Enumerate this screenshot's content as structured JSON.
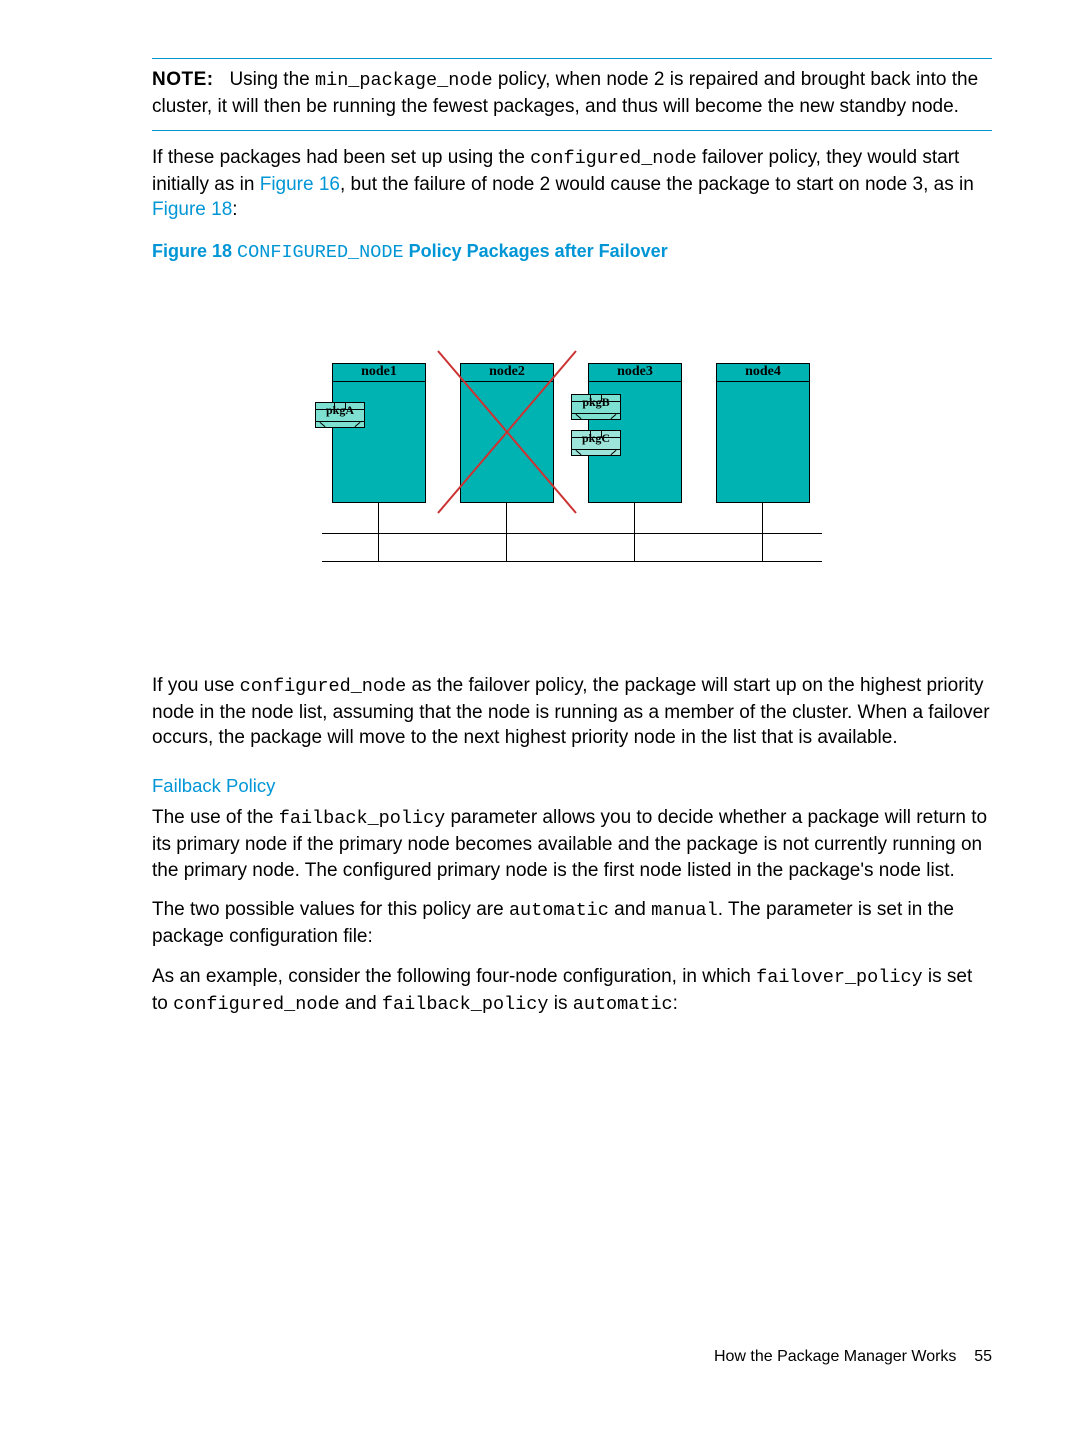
{
  "note": {
    "label": "NOTE:",
    "before_code": "Using the ",
    "code": "min_package_node",
    "after_code": " policy, when node 2 is repaired and brought back into the cluster, it will then be running the fewest packages, and thus will become the new standby node."
  },
  "para1": {
    "t1": "If these packages had been set up using the ",
    "c1": "configured_node",
    "t2": " failover policy, they would start initially as in ",
    "link1": "Figure 16",
    "t3": ", but the failure of node 2 would cause the package to start on node 3, as in ",
    "link2": "Figure 18",
    "t4": ":"
  },
  "figcap": {
    "prefix": "Figure 18 ",
    "code": "CONFIGURED_NODE",
    "suffix": " Policy Packages after Failover"
  },
  "diagram": {
    "nodes": [
      "node1",
      "node2",
      "node3",
      "node4"
    ],
    "pkgA": "pkgA",
    "pkgB": "pkgB",
    "pkgC": "pkgC"
  },
  "para2": {
    "t1": "If you use ",
    "c1": "configured_node",
    "t2": " as the failover policy, the package will start up on the highest priority node in the node list, assuming that the node is running as a member of the cluster. When a failover occurs, the package will move to the next highest priority node in the list that is available."
  },
  "h3": "Failback Policy",
  "para3": {
    "t1": "The use of the ",
    "c1": "failback_policy",
    "t2": " parameter allows you to decide whether a package will return to its primary node if the primary node becomes available and the package is not currently running on the primary node. The configured primary node is the first node listed in the package's node list."
  },
  "para4": {
    "t1": "The two possible values for this policy are ",
    "c1": "automatic",
    "t2": " and ",
    "c2": "manual",
    "t3": ". The parameter is set in the package configuration file:"
  },
  "para5": {
    "t1": "As an example, consider the following four-node configuration, in which ",
    "c1": "failover_policy",
    "t2": " is set to ",
    "c2": "configured_node",
    "t3": " and ",
    "c3": "failback_policy",
    "t4": " is ",
    "c4": "automatic",
    "t5": ":"
  },
  "footer": {
    "title": "How the Package Manager Works",
    "page": "55"
  }
}
